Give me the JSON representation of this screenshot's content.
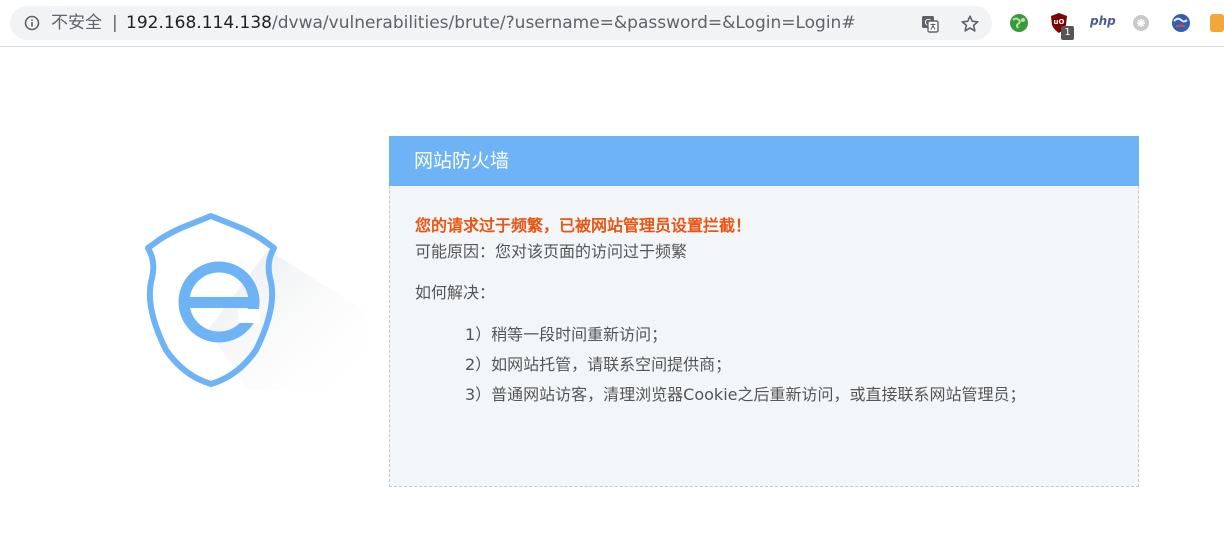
{
  "browser": {
    "security_label": "不安全",
    "separator": "|",
    "url_host": "192.168.114.138",
    "url_path": "/dvwa/vulnerabilities/brute/?username=&password=&Login=Login#",
    "icons": [
      "info-icon",
      "translate-icon",
      "bookmark-star-icon"
    ],
    "extensions": [
      {
        "name": "globe-extension-icon",
        "color": "#3a9a3a"
      },
      {
        "name": "ublock-extension-icon",
        "color": "#800000",
        "badge": "1"
      },
      {
        "name": "php-extension-icon",
        "label": "php",
        "color": "#4f5b93"
      },
      {
        "name": "puzzle-extension-icon",
        "color": "#b0b0b0"
      },
      {
        "name": "world-extension-icon",
        "color": "#2f5fb3"
      }
    ]
  },
  "firewall": {
    "header": "网站防火墙",
    "alert": "您的请求过于频繁，已被网站管理员设置拦截！",
    "reason": "可能原因：您对该页面的访问过于频繁",
    "howto": "如何解决：",
    "steps": [
      "1）稍等一段时间重新访问；",
      "2）如网站托管，请联系空间提供商；",
      "3）普通网站访客，清理浏览器Cookie之后重新访问，或直接联系网站管理员；"
    ],
    "logo_icon": "shield-e-logo-icon",
    "colors": {
      "header_bg": "#6db3f5",
      "alert": "#ea5514",
      "panel_bg": "#f3f6f9",
      "logo": "#6db3f5"
    }
  }
}
